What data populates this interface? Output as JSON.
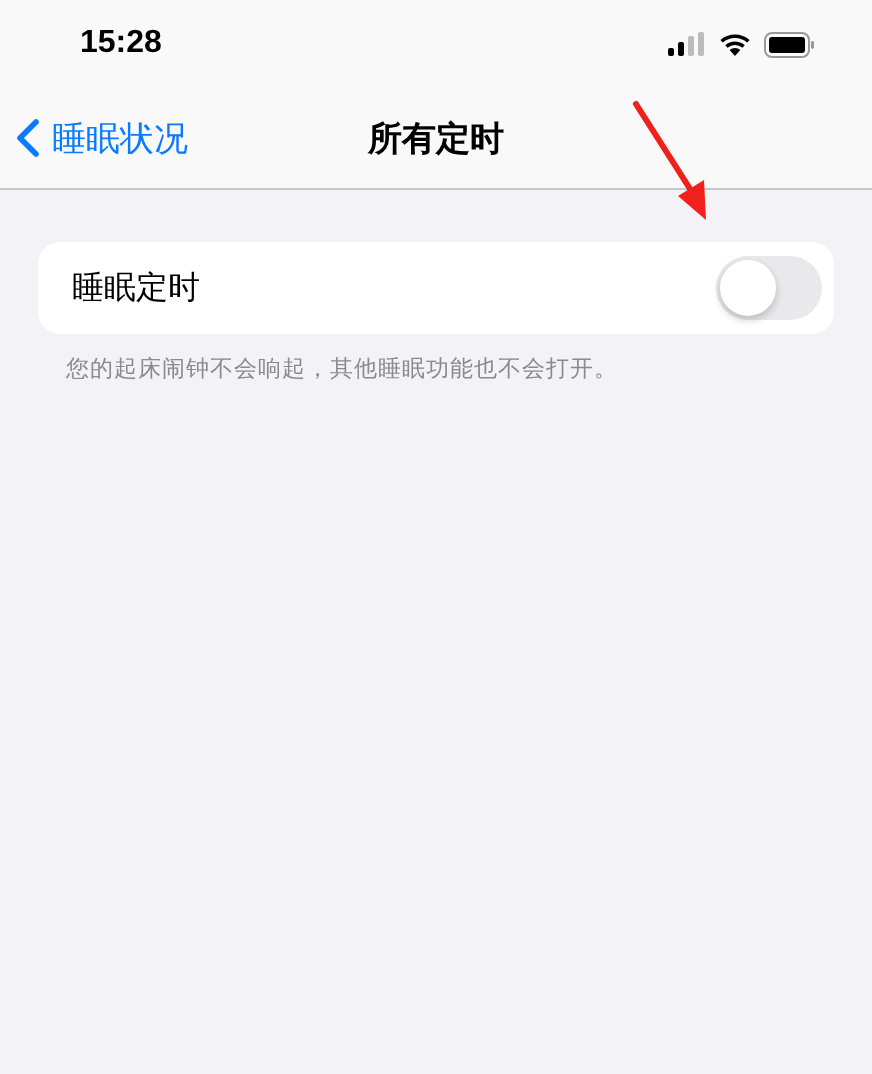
{
  "status_bar": {
    "time": "15:28"
  },
  "nav_bar": {
    "back_label": "睡眠状况",
    "title": "所有定时"
  },
  "settings": [
    {
      "kind": "toggle",
      "label": "睡眠定时",
      "on": false
    }
  ],
  "footer_note": "您的起床闹钟不会响起，其他睡眠功能也不会打开。",
  "annotation": {
    "kind": "arrow"
  }
}
